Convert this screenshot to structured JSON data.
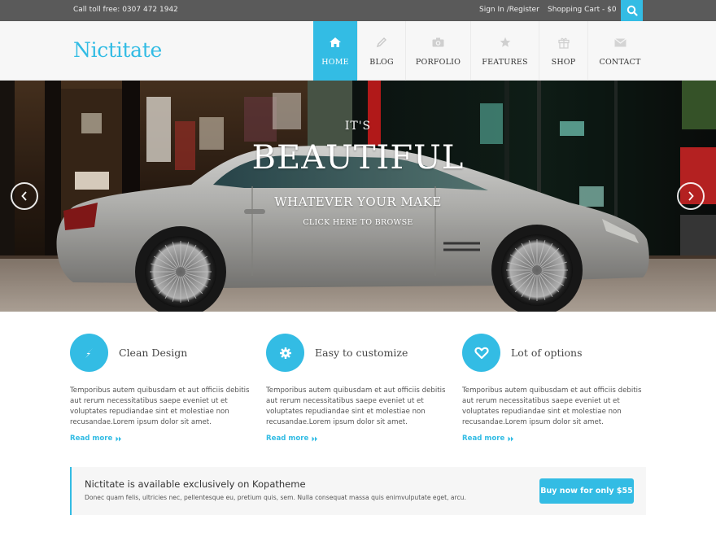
{
  "topbar": {
    "phone": "Call toll free: 0307 472 1942",
    "signin": "Sign In /Register",
    "cart": "Shopping Cart - $0",
    "search_icon": "search-icon"
  },
  "header": {
    "logo": "Nictitate",
    "nav": [
      {
        "label": "HOME",
        "icon": "home-icon",
        "active": true
      },
      {
        "label": "BLOG",
        "icon": "pencil-icon",
        "active": false
      },
      {
        "label": "PORFOLIO",
        "icon": "camera-icon",
        "active": false
      },
      {
        "label": "FEATURES",
        "icon": "star-icon",
        "active": false
      },
      {
        "label": "SHOP",
        "icon": "gift-icon",
        "active": false
      },
      {
        "label": "CONTACT",
        "icon": "envelope-icon",
        "active": false
      }
    ]
  },
  "hero": {
    "line1": "IT'S",
    "line2": "BEAUTIFUL",
    "line3": "WHATEVER YOUR MAKE",
    "cta": "CLICK HERE TO BROWSE",
    "prev_icon": "chevron-left-icon",
    "next_icon": "chevron-right-icon"
  },
  "features": [
    {
      "title": "Clean Design",
      "icon": "lightning-icon",
      "text": "Temporibus autem quibusdam et aut officiis debitis aut rerum necessitatibus saepe eveniet ut et voluptates repudiandae sint et molestiae non recusandae.Lorem ipsum dolor sit amet.",
      "more": "Read more"
    },
    {
      "title": "Easy to customize",
      "icon": "gear-icon",
      "text": "Temporibus autem quibusdam et aut officiis debitis aut rerum necessitatibus saepe eveniet ut et voluptates repudiandae sint et molestiae non recusandae.Lorem ipsum dolor sit amet.",
      "more": "Read more"
    },
    {
      "title": "Lot of options",
      "icon": "heart-icon",
      "text": "Temporibus autem quibusdam et aut officiis debitis aut rerum necessitatibus saepe eveniet ut et voluptates repudiandae sint et molestiae non recusandae.Lorem ipsum dolor sit amet.",
      "more": "Read more"
    }
  ],
  "callout": {
    "title": "Nictitate is available exclusively on Kopatheme",
    "text": "Donec quam felis, ultricies nec, pellentesque eu, pretium quis, sem. Nulla consequat massa quis enimvulputate eget, arcu.",
    "button": "Buy now for only $55"
  },
  "colors": {
    "accent": "#33bce4",
    "topbar": "#5a5a5a",
    "header_bg": "#f7f7f7"
  }
}
